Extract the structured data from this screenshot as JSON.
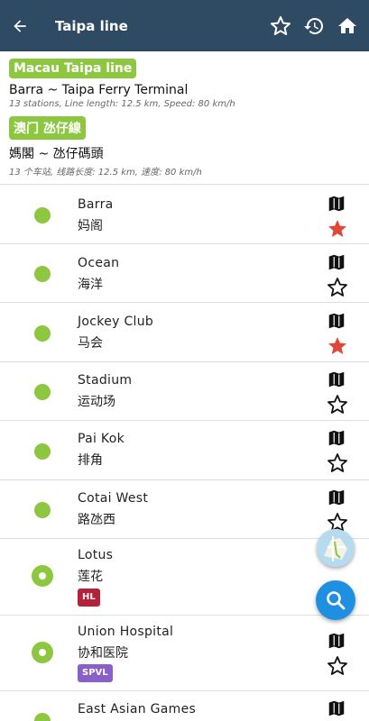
{
  "appbar": {
    "title": "Taipa line",
    "icons": [
      "back-arrow-icon",
      "star-outline-icon",
      "history-icon",
      "home-icon"
    ]
  },
  "info": {
    "name_en": "Macau Taipa line",
    "route_en": "Barra ~ Taipa Ferry Terminal",
    "meta_en": "13 stations, Line length: 12.5 km, Speed: 80 km/h",
    "name_zh": "澳门 氹仔線",
    "route_zh": "媽閣 ~ 氹仔碼頭",
    "meta_zh": "13 个车站, 线路长度: 12.5 km, 速度: 80 km/h"
  },
  "stations": [
    {
      "name": "Barra",
      "cn": "妈阁",
      "favorite": true,
      "interchange": false,
      "tag": ""
    },
    {
      "name": "Ocean",
      "cn": "海洋",
      "favorite": false,
      "interchange": false,
      "tag": ""
    },
    {
      "name": "Jockey Club",
      "cn": "马会",
      "favorite": true,
      "interchange": false,
      "tag": ""
    },
    {
      "name": "Stadium",
      "cn": "运动场",
      "favorite": false,
      "interchange": false,
      "tag": ""
    },
    {
      "name": "Pai Kok",
      "cn": "排角",
      "favorite": false,
      "interchange": false,
      "tag": ""
    },
    {
      "name": "Cotai West",
      "cn": "路氹西",
      "favorite": false,
      "interchange": false,
      "tag": ""
    },
    {
      "name": "Lotus",
      "cn": "莲花",
      "favorite": false,
      "interchange": true,
      "tag": "HL"
    },
    {
      "name": "Union Hospital",
      "cn": "协和医院",
      "favorite": false,
      "interchange": true,
      "tag": "SPVL"
    },
    {
      "name": "East Asian Games",
      "cn": "",
      "favorite": false,
      "interchange": false,
      "tag": ""
    }
  ],
  "colors": {
    "appbar": "#2f4a63",
    "line_green": "#8dc63f",
    "star_red": "#e0463a",
    "tag_hl": "#b3213a",
    "tag_spvl": "#8a5fc7",
    "fab_blue": "#1e8fe1"
  },
  "fabs": {
    "map_icon": "map-thumbnail-icon",
    "search_icon": "search-icon"
  }
}
